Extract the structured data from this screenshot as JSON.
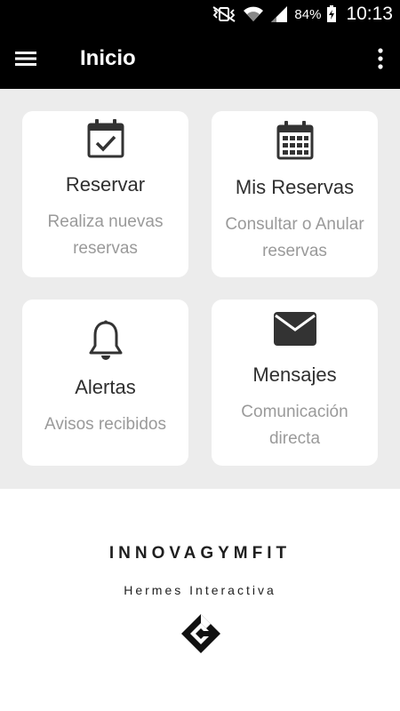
{
  "status_bar": {
    "battery_percent": "84%",
    "time": "10:13",
    "icons": [
      "vibrate-muted-icon",
      "wifi-icon",
      "signal-icon",
      "battery-charging-icon"
    ]
  },
  "app_bar": {
    "title": "Inicio",
    "left_icon": "hamburger-menu-icon",
    "right_icon": "more-vertical-icon"
  },
  "cards": [
    {
      "title": "Reservar",
      "description": "Realiza nuevas reservas",
      "icon": "calendar-check-icon"
    },
    {
      "title": "Mis Reservas",
      "description": "Consultar o Anular reservas",
      "icon": "calendar-grid-icon"
    },
    {
      "title": "Alertas",
      "description": "Avisos recibidos",
      "icon": "bell-icon"
    },
    {
      "title": "Mensajes",
      "description": "Comunicación directa",
      "icon": "envelope-icon"
    }
  ],
  "footer": {
    "brand": "INNOVAGYMFIT",
    "subtitle": "Hermes Interactiva",
    "logo_icon": "hermes-g-logo-icon"
  },
  "colors": {
    "app_bar": "#000000",
    "content_background": "#ececec",
    "card_background": "#ffffff",
    "title_text": "#2f2f2f",
    "description_text": "#9a9a9a"
  }
}
